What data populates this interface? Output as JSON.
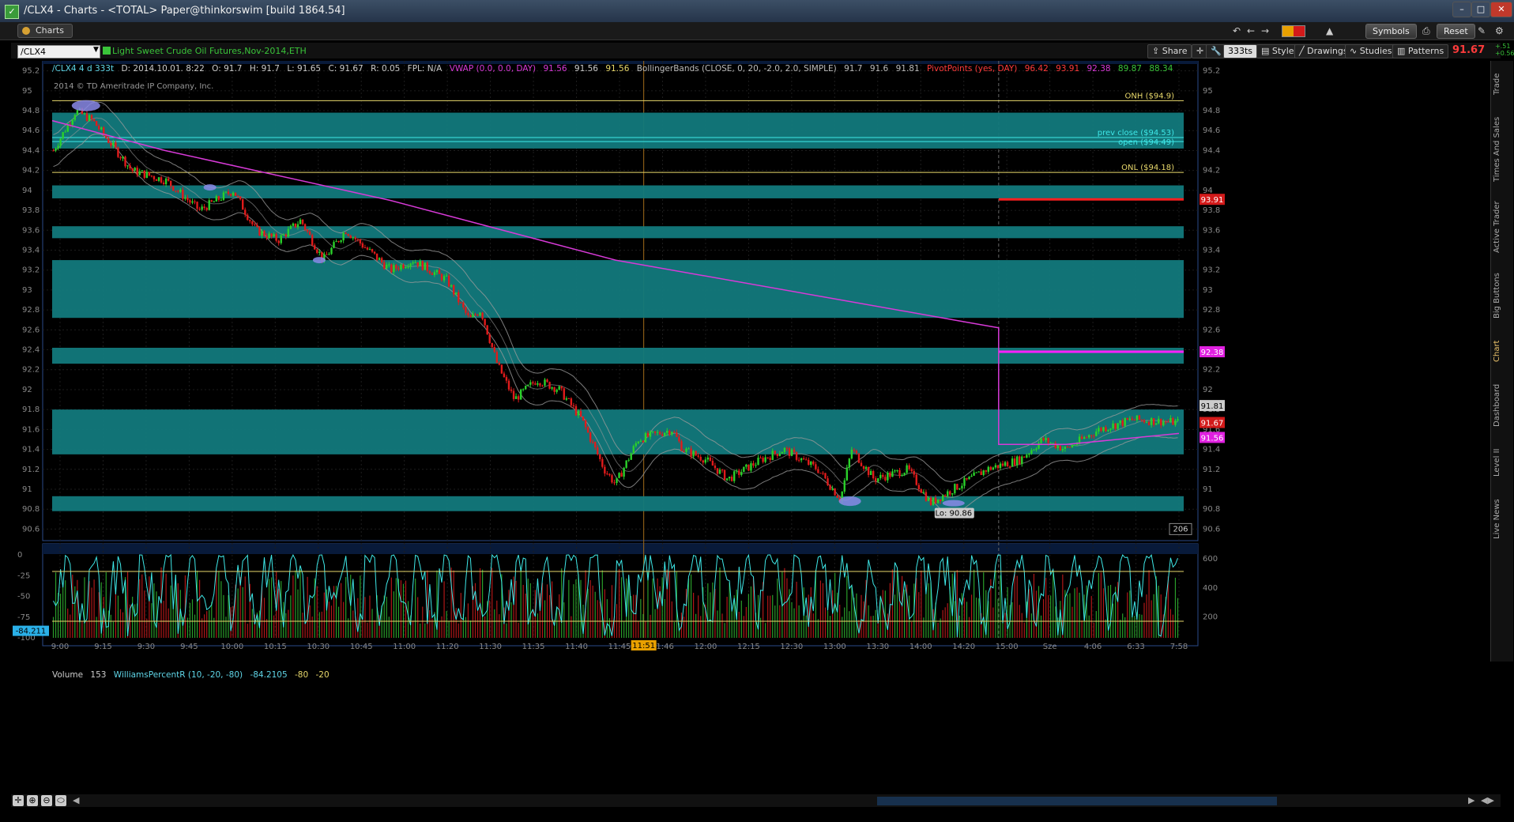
{
  "window": {
    "title": "/CLX4 - Charts - <TOTAL> Paper@thinkorswim [build 1864.54]"
  },
  "toolbar": {
    "charts_tab": "Charts",
    "symbols": "Symbols",
    "reset": "Reset"
  },
  "chart_toolbar": {
    "symbol": "/CLX4",
    "description": "Light Sweet Crude Oil Futures,Nov-2014,ETH",
    "share": "Share",
    "aggregation": "333ts",
    "style": "Style",
    "drawings": "Drawings",
    "studies": "Studies",
    "patterns": "Patterns",
    "last_price": "91.67",
    "net_change": "+.51",
    "pct_change": "+0.56%"
  },
  "info_bar": {
    "symbol_period": "/CLX4 4 d 333t",
    "date": "D: 2014.10.01. 8:22",
    "open": "O: 91.7",
    "high": "H: 91.7",
    "low": "L: 91.65",
    "close": "C: 91.67",
    "range": "R: 0.05",
    "fpl": "FPL: N/A",
    "vwap_label": "VWAP (0.0, 0.0, DAY)",
    "vwap_v1": "91.56",
    "vwap_v2": "91.56",
    "vwap_v3": "91.56",
    "bb_label": "BollingerBands (CLOSE, 0, 20, -2.0, 2.0, SIMPLE)",
    "bb_v1": "91.7",
    "bb_v2": "91.6",
    "bb_v3": "91.81",
    "pp_label": "PivotPoints (yes, DAY)",
    "pp_v1": "96.42",
    "pp_v2": "93.91",
    "pp_v3": "92.38",
    "pp_v4": "89.87",
    "pp_v5": "88.34"
  },
  "copyright": "2014 © TD Ameritrade IP Company, Inc.",
  "lower_info": {
    "volume_label": "Volume",
    "volume_value": "153",
    "wpr_label": "WilliamsPercentR (10, -20, -80)",
    "wpr_value": "-84.2105",
    "wpr_p1": "-80",
    "wpr_p2": "-20",
    "wpr_badge": "-84.211"
  },
  "price_axis": {
    "ticks": [
      "95.2",
      "95",
      "94.8",
      "94.6",
      "94.4",
      "94.2",
      "94",
      "93.8",
      "93.6",
      "93.4",
      "93.2",
      "93",
      "92.8",
      "92.6",
      "92.4",
      "92.2",
      "92",
      "91.8",
      "91.6",
      "91.4",
      "91.2",
      "91",
      "90.8",
      "90.6"
    ]
  },
  "lower_left_axis": {
    "ticks": [
      "0",
      "-25",
      "-50",
      "-75",
      "-100"
    ]
  },
  "lower_right_axis": {
    "ticks": [
      "600",
      "400",
      "200"
    ]
  },
  "time_axis": {
    "ticks": [
      "9:00",
      "9:15",
      "9:30",
      "9:45",
      "10:00",
      "10:15",
      "10:30",
      "10:45",
      "11:00",
      "11:20",
      "11:30",
      "11:35",
      "11:40",
      "11:45",
      "11:46",
      "12:00",
      "12:15",
      "12:30",
      "13:00",
      "13:30",
      "14:00",
      "14:20",
      "15:00",
      "Sze",
      "4:06",
      "6:33",
      "7:58"
    ],
    "cursor_label": "11:51"
  },
  "annotations": {
    "onh": "ONH ($94.9)",
    "prev_close": "prev close ($94.53)",
    "open": "open ($94.49)",
    "onl": "ONL ($94.18)",
    "low_label": "Lo: 90.86",
    "bar_count": "206"
  },
  "price_badges": {
    "pivot_r": "93.91",
    "pivot_pp": "92.38",
    "bb_upper": "91.81",
    "last": "91.67",
    "vwap": "91.56"
  },
  "side_tabs": [
    "Trade",
    "Times And Sales",
    "Active Trader",
    "Big Buttons",
    "Chart",
    "Dashboard",
    "Level II",
    "Live News"
  ],
  "colors": {
    "band": "#12797c",
    "up": "#2ad12a",
    "down": "#e01b1b",
    "vwap": "#d83ad8",
    "bb": "#9a9a9a",
    "level": "#e8d86b",
    "prev_close": "#3ee8e8"
  },
  "chart_data": {
    "type": "candlestick",
    "ylim": [
      90.5,
      95.3
    ],
    "support_resistance_bands": [
      [
        94.42,
        94.78
      ],
      [
        93.92,
        94.05
      ],
      [
        93.52,
        93.64
      ],
      [
        92.72,
        93.3
      ],
      [
        92.26,
        92.42
      ],
      [
        91.35,
        91.8
      ],
      [
        90.78,
        90.93
      ]
    ],
    "levels": {
      "onh": 94.9,
      "prev_close": 94.53,
      "open": 94.49,
      "onl": 94.18,
      "pivot_r1": 93.91,
      "pivot_pp": 92.38
    },
    "price_path": [
      [
        0,
        94.4
      ],
      [
        0.02,
        94.8
      ],
      [
        0.035,
        94.7
      ],
      [
        0.07,
        94.2
      ],
      [
        0.1,
        94.1
      ],
      [
        0.13,
        93.8
      ],
      [
        0.16,
        94
      ],
      [
        0.18,
        93.6
      ],
      [
        0.2,
        93.5
      ],
      [
        0.22,
        93.7
      ],
      [
        0.24,
        93.3
      ],
      [
        0.26,
        93.6
      ],
      [
        0.28,
        93.4
      ],
      [
        0.3,
        93.2
      ],
      [
        0.32,
        93.3
      ],
      [
        0.35,
        93.1
      ],
      [
        0.37,
        92.7
      ],
      [
        0.38,
        92.8
      ],
      [
        0.395,
        92.25
      ],
      [
        0.41,
        91.9
      ],
      [
        0.43,
        92.1
      ],
      [
        0.45,
        92
      ],
      [
        0.47,
        91.7
      ],
      [
        0.49,
        91.2
      ],
      [
        0.5,
        91.05
      ],
      [
        0.52,
        91.5
      ],
      [
        0.55,
        91.6
      ],
      [
        0.56,
        91.4
      ],
      [
        0.58,
        91.3
      ],
      [
        0.6,
        91.1
      ],
      [
        0.63,
        91.3
      ],
      [
        0.65,
        91.4
      ],
      [
        0.68,
        91.2
      ],
      [
        0.7,
        90.9
      ],
      [
        0.71,
        91.4
      ],
      [
        0.73,
        91.1
      ],
      [
        0.76,
        91.2
      ],
      [
        0.78,
        90.86
      ],
      [
        0.8,
        91
      ],
      [
        0.83,
        91.2
      ],
      [
        0.86,
        91.3
      ],
      [
        0.88,
        91.5
      ],
      [
        0.9,
        91.4
      ],
      [
        0.93,
        91.6
      ],
      [
        0.96,
        91.7
      ],
      [
        1,
        91.67
      ]
    ],
    "vwap_path": [
      [
        0,
        94.7
      ],
      [
        0.1,
        94.4
      ],
      [
        0.3,
        93.9
      ],
      [
        0.5,
        93.3
      ],
      [
        0.7,
        92.9
      ],
      [
        0.8,
        92.7
      ],
      [
        0.84,
        92.62
      ],
      [
        0.84,
        91.45
      ],
      [
        0.9,
        91.45
      ],
      [
        1,
        91.56
      ]
    ]
  }
}
